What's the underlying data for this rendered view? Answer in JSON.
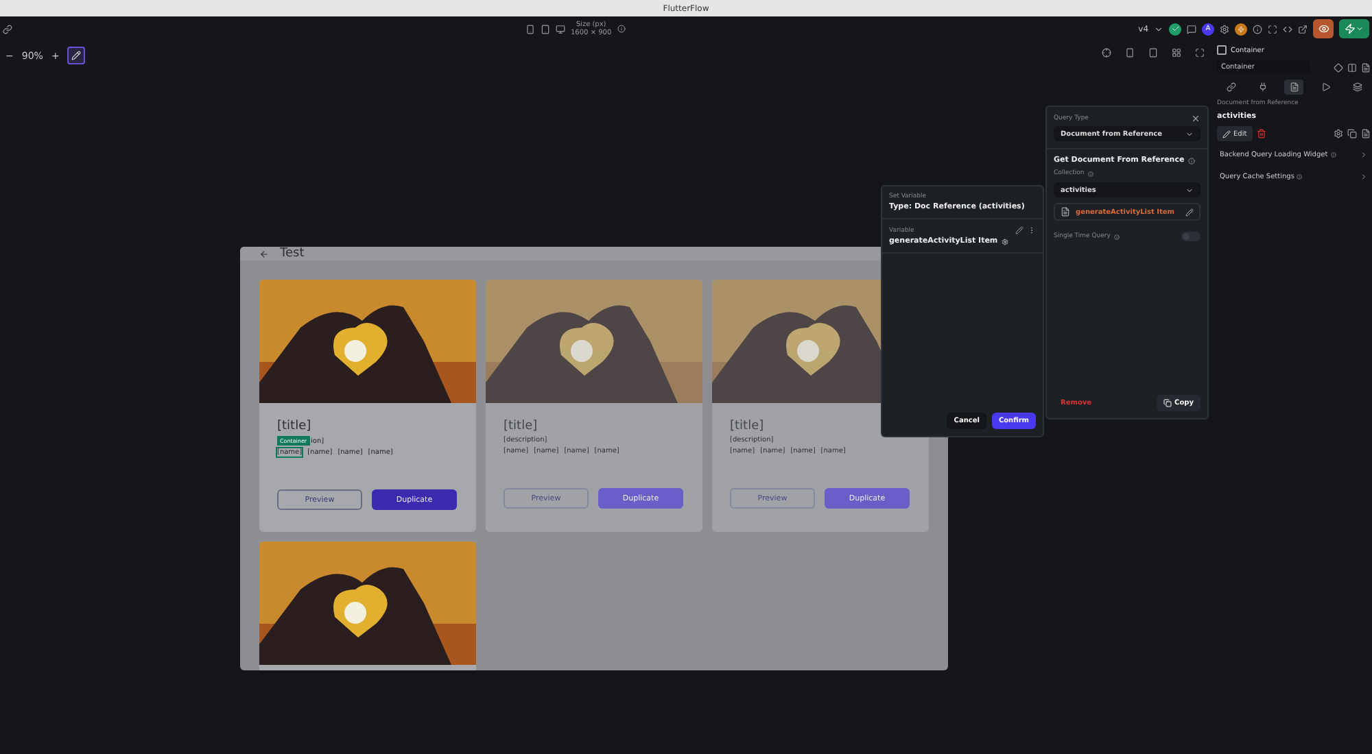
{
  "window": {
    "title": "FlutterFlow"
  },
  "toolbar": {
    "size_label": "Size (px)",
    "size_value": "1600 × 900",
    "version": "v4",
    "avatar_initial": "A"
  },
  "zoom": {
    "value": "90%",
    "minus": "−",
    "plus": "+"
  },
  "preview": {
    "title": "Test",
    "cards": [
      {
        "kind": "full",
        "dimmed": false,
        "title": "[title]",
        "badge": "Container",
        "description": "ion]",
        "tags": [
          {
            "label": "[name]",
            "selected": true
          },
          {
            "label": "[name]",
            "selected": false
          },
          {
            "label": "[name]",
            "selected": false
          },
          {
            "label": "[name]",
            "selected": false
          }
        ],
        "buttons": [
          "Preview",
          "Duplicate"
        ]
      },
      {
        "kind": "full",
        "dimmed": true,
        "title": "[title]",
        "description": "[description]",
        "tags": [
          {
            "label": "[name]",
            "selected": false
          },
          {
            "label": "[name]",
            "selected": false
          },
          {
            "label": "[name]",
            "selected": false
          },
          {
            "label": "[name]",
            "selected": false
          }
        ],
        "buttons": [
          "Preview",
          "Duplicate"
        ]
      },
      {
        "kind": "full",
        "dimmed": true,
        "title": "[title]",
        "description": "[description]",
        "tags": [
          {
            "label": "[name]",
            "selected": false
          },
          {
            "label": "[name]",
            "selected": false
          },
          {
            "label": "[name]",
            "selected": false
          },
          {
            "label": "[name]",
            "selected": false
          }
        ],
        "buttons": [
          "Preview",
          "Duplicate"
        ]
      },
      {
        "kind": "image_only"
      }
    ]
  },
  "set_variable": {
    "heading": "Set Variable",
    "type": "Type: Doc Reference (activities)",
    "variable_label": "Variable",
    "variable": "generateActivityList Item",
    "buttons": [
      "Cancel",
      "Confirm"
    ]
  },
  "query": {
    "type_label": "Query Type",
    "type_value": "Document from Reference",
    "heading": "Get Document From Reference",
    "collection_label": "Collection",
    "collection": "activities",
    "variable": "generateActivityList Item",
    "single_time_label": "Single Time Query",
    "single_time_on": false,
    "remove": "Remove",
    "copy": "Copy"
  },
  "properties": {
    "checkbox_label": "Container",
    "checked": false,
    "name_value": "Container",
    "tabs": [
      {
        "selected": false
      },
      {
        "selected": false
      },
      {
        "selected": true
      },
      {
        "selected": false
      },
      {
        "selected": false
      }
    ],
    "section_label": "Document from Reference",
    "section_value": "activities",
    "edit": "Edit",
    "rows": [
      "Backend Query Loading Widget",
      "Query Cache Settings"
    ]
  }
}
